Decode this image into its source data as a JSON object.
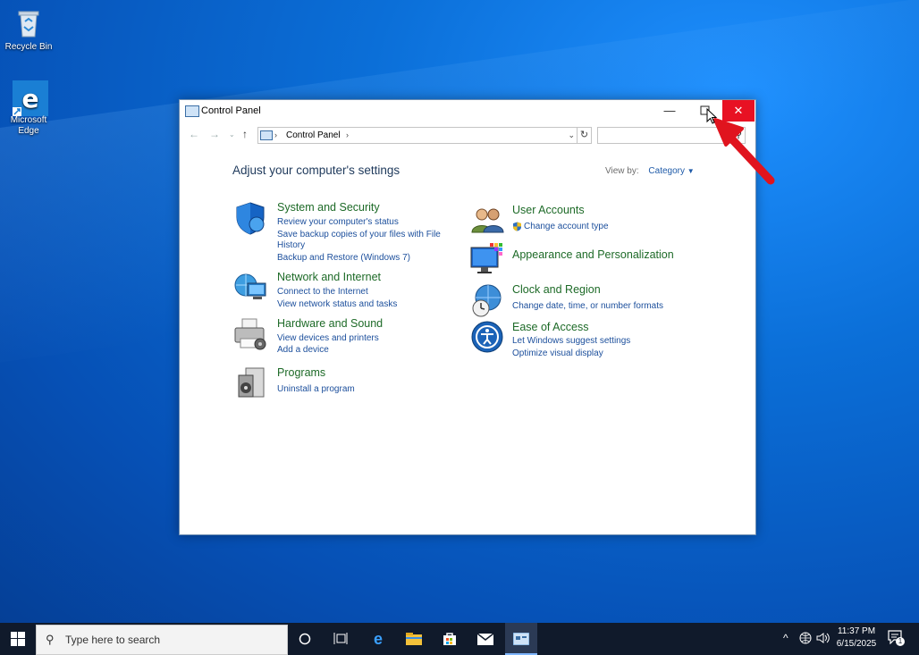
{
  "desktop": {
    "icons": [
      {
        "label": "Recycle Bin"
      },
      {
        "label": "Microsoft Edge"
      }
    ]
  },
  "window": {
    "title": "Control Panel",
    "address": "Control Panel",
    "heading": "Adjust your computer's settings",
    "view_by_label": "View by:",
    "view_by_value": "Category",
    "categories": [
      {
        "title": "System and Security",
        "links": [
          "Review your computer's status",
          "Save backup copies of your files with File",
          "History",
          "Backup and Restore (Windows 7)"
        ]
      },
      {
        "title": "Network and Internet",
        "links": [
          "Connect to the Internet",
          "View network status and tasks"
        ]
      },
      {
        "title": "Hardware and Sound",
        "links": [
          "View devices and printers",
          "Add a device"
        ]
      },
      {
        "title": "Programs",
        "links": [
          "Uninstall a program"
        ]
      },
      {
        "title": "User Accounts",
        "links": [
          "Change account type"
        ]
      },
      {
        "title": "Appearance and Personalization",
        "links": []
      },
      {
        "title": "Clock and Region",
        "links": [
          "Change date, time, or number formats"
        ]
      },
      {
        "title": "Ease of Access",
        "links": [
          "Let Windows suggest settings",
          "Optimize visual display"
        ]
      }
    ]
  },
  "taskbar": {
    "search_placeholder": "Type here to search",
    "time": "11:37 PM",
    "date": "6/15/2025",
    "notification_count": "1"
  },
  "colors": {
    "close_button": "#e81123",
    "category_title": "#1d6a27",
    "link": "#1c4f9c",
    "annotation_arrow": "#e0141e"
  }
}
